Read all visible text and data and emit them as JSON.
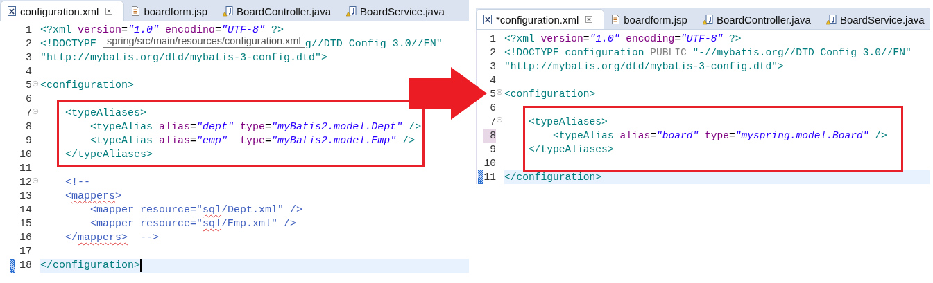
{
  "panes": [
    {
      "tabs": [
        {
          "label": "configuration.xml",
          "kind": "xml",
          "selected": true
        },
        {
          "label": "boardform.jsp",
          "kind": "jsp",
          "selected": false
        },
        {
          "label": "BoardController.java",
          "kind": "java",
          "selected": false
        },
        {
          "label": "BoardService.java",
          "kind": "java",
          "selected": false
        }
      ],
      "lines": [
        {
          "number": "1",
          "tokens": [
            {
              "text": "<?xml",
              "kind": "tag"
            },
            {
              "text": " version",
              "kind": "attr"
            },
            {
              "text": "=",
              "kind": "plain"
            },
            {
              "text": "\"1.0\"",
              "kind": "value"
            },
            {
              "text": " encoding",
              "kind": "attr"
            },
            {
              "text": "=",
              "kind": "plain"
            },
            {
              "text": "\"UTF-8\"",
              "kind": "value"
            },
            {
              "text": " ?>",
              "kind": "tag"
            }
          ]
        },
        {
          "number": "2",
          "tokens": [
            {
              "text": "<!DOCTYPE ",
              "kind": "tag"
            },
            {
              "text": "spring/src/main/resources/configuration.xml",
              "kind": "tooltip"
            },
            {
              "text": "g//DTD Config 3.0//EN\"",
              "kind": "tag"
            }
          ]
        },
        {
          "number": "3",
          "tokens": [
            {
              "text": "\"http://mybatis.org/dtd/mybatis-3-config.dtd\">",
              "kind": "tag"
            }
          ]
        },
        {
          "number": "4"
        },
        {
          "number": "5",
          "fold": true,
          "tokens": [
            {
              "text": "<configuration>",
              "kind": "tag"
            }
          ]
        },
        {
          "number": "6"
        },
        {
          "number": "7",
          "fold": true,
          "boxed": true,
          "tokens": [
            {
              "text": "    <typeAliases>",
              "kind": "tag"
            }
          ]
        },
        {
          "number": "8",
          "boxed": true,
          "tokens": [
            {
              "text": "        <typeAlias",
              "kind": "tag"
            },
            {
              "text": " alias",
              "kind": "attr"
            },
            {
              "text": "=",
              "kind": "plain"
            },
            {
              "text": "\"dept\"",
              "kind": "value"
            },
            {
              "text": " type",
              "kind": "attr"
            },
            {
              "text": "=",
              "kind": "plain"
            },
            {
              "text": "\"myBatis2.model.Dept\"",
              "kind": "value"
            },
            {
              "text": " />",
              "kind": "tag"
            }
          ]
        },
        {
          "number": "9",
          "boxed": true,
          "tokens": [
            {
              "text": "        <typeAlias",
              "kind": "tag"
            },
            {
              "text": " alias",
              "kind": "attr"
            },
            {
              "text": "=",
              "kind": "plain"
            },
            {
              "text": "\"emp\"",
              "kind": "value"
            },
            {
              "text": "  type",
              "kind": "attr"
            },
            {
              "text": "=",
              "kind": "plain"
            },
            {
              "text": "\"myBatis2.model.Emp\"",
              "kind": "value"
            },
            {
              "text": " />",
              "kind": "tag"
            }
          ]
        },
        {
          "number": "10",
          "boxed": true,
          "tokens": [
            {
              "text": "    </typeAliases>",
              "kind": "tag"
            }
          ]
        },
        {
          "number": "11"
        },
        {
          "number": "12",
          "fold": true,
          "tokens": [
            {
              "text": "    <!--",
              "kind": "comment"
            }
          ]
        },
        {
          "number": "13",
          "tokens": [
            {
              "text": "    <",
              "kind": "comment"
            },
            {
              "text": "mappers",
              "kind": "comment",
              "squiggle": true
            },
            {
              "text": ">",
              "kind": "comment"
            }
          ]
        },
        {
          "number": "14",
          "tokens": [
            {
              "text": "        <mapper resource=\"",
              "kind": "comment"
            },
            {
              "text": "sql",
              "kind": "comment",
              "squiggle": true
            },
            {
              "text": "/Dept.xml\" />",
              "kind": "comment"
            }
          ]
        },
        {
          "number": "15",
          "tokens": [
            {
              "text": "        <mapper resource=\"",
              "kind": "comment"
            },
            {
              "text": "sql",
              "kind": "comment",
              "squiggle": true
            },
            {
              "text": "/Emp.xml\" />",
              "kind": "comment"
            }
          ]
        },
        {
          "number": "16",
          "tokens": [
            {
              "text": "    </",
              "kind": "comment"
            },
            {
              "text": "mappers>",
              "kind": "comment",
              "squiggle": true
            },
            {
              "text": "  -->",
              "kind": "comment"
            }
          ]
        },
        {
          "number": "17"
        },
        {
          "number": "18",
          "current": true,
          "cursor": true,
          "tokens": [
            {
              "text": "</configuration>",
              "kind": "tag"
            }
          ]
        }
      ]
    },
    {
      "tabs": [
        {
          "label": "*configuration.xml",
          "kind": "xml",
          "selected": true
        },
        {
          "label": "boardform.jsp",
          "kind": "jsp",
          "selected": false
        },
        {
          "label": "BoardController.java",
          "kind": "java",
          "selected": false
        },
        {
          "label": "BoardService.java",
          "kind": "java",
          "selected": false
        }
      ],
      "lines": [
        {
          "number": "1",
          "tokens": [
            {
              "text": "<?xml",
              "kind": "tag"
            },
            {
              "text": " version",
              "kind": "attr"
            },
            {
              "text": "=",
              "kind": "plain"
            },
            {
              "text": "\"1.0\"",
              "kind": "value"
            },
            {
              "text": " encoding",
              "kind": "attr"
            },
            {
              "text": "=",
              "kind": "plain"
            },
            {
              "text": "\"UTF-8\"",
              "kind": "value"
            },
            {
              "text": " ?>",
              "kind": "tag"
            }
          ]
        },
        {
          "number": "2",
          "tokens": [
            {
              "text": "<!DOCTYPE configuration ",
              "kind": "tag"
            },
            {
              "text": "PUBLIC",
              "kind": "keyword"
            },
            {
              "text": " \"-//mybatis.org//DTD Config 3.0//EN\"",
              "kind": "tag"
            }
          ]
        },
        {
          "number": "3",
          "tokens": [
            {
              "text": "\"http://mybatis.org/dtd/mybatis-3-config.dtd\">",
              "kind": "tag"
            }
          ]
        },
        {
          "number": "4"
        },
        {
          "number": "5",
          "fold": true,
          "tokens": [
            {
              "text": "<configuration>",
              "kind": "tag"
            }
          ]
        },
        {
          "number": "6"
        },
        {
          "number": "7",
          "fold": true,
          "boxed": true,
          "tokens": [
            {
              "text": "    <typeAliases>",
              "kind": "tag"
            }
          ]
        },
        {
          "number": "8",
          "marked": true,
          "boxed": true,
          "tokens": [
            {
              "text": "        <typeAlias",
              "kind": "tag"
            },
            {
              "text": " alias",
              "kind": "attr"
            },
            {
              "text": "=",
              "kind": "plain"
            },
            {
              "text": "\"board\"",
              "kind": "value"
            },
            {
              "text": " type",
              "kind": "attr"
            },
            {
              "text": "=",
              "kind": "plain"
            },
            {
              "text": "\"myspring.model.Board\"",
              "kind": "value"
            },
            {
              "text": " />",
              "kind": "tag"
            }
          ]
        },
        {
          "number": "9",
          "boxed": true,
          "tokens": [
            {
              "text": "    </typeAliases>",
              "kind": "tag"
            }
          ]
        },
        {
          "number": "10"
        },
        {
          "number": "11",
          "current": true,
          "tokens": [
            {
              "text": "</configuration>",
              "kind": "tag"
            }
          ]
        }
      ]
    }
  ]
}
